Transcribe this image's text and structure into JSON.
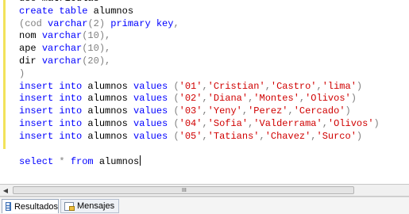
{
  "editor": {
    "lines": [
      [
        {
          "t": "use matriculas",
          "c": "plain"
        }
      ],
      [
        {
          "t": "create table",
          "c": "kw"
        },
        {
          "t": " alumnos",
          "c": "plain"
        }
      ],
      [
        {
          "t": "(cod ",
          "c": "gray"
        },
        {
          "t": "varchar",
          "c": "kw"
        },
        {
          "t": "(2) ",
          "c": "gray"
        },
        {
          "t": "primary key",
          "c": "kw"
        },
        {
          "t": ",",
          "c": "gray"
        }
      ],
      [
        {
          "t": "nom ",
          "c": "plain"
        },
        {
          "t": "varchar",
          "c": "kw"
        },
        {
          "t": "(10),",
          "c": "gray"
        }
      ],
      [
        {
          "t": "ape ",
          "c": "plain"
        },
        {
          "t": "varchar",
          "c": "kw"
        },
        {
          "t": "(10),",
          "c": "gray"
        }
      ],
      [
        {
          "t": "dir ",
          "c": "plain"
        },
        {
          "t": "varchar",
          "c": "kw"
        },
        {
          "t": "(20),",
          "c": "gray"
        }
      ],
      [
        {
          "t": ")",
          "c": "gray"
        }
      ],
      [
        {
          "t": "insert into",
          "c": "kw"
        },
        {
          "t": " alumnos ",
          "c": "plain"
        },
        {
          "t": "values",
          "c": "kw"
        },
        {
          "t": " (",
          "c": "gray"
        },
        {
          "t": "'01'",
          "c": "str"
        },
        {
          "t": ",",
          "c": "gray"
        },
        {
          "t": "'Cristian'",
          "c": "str"
        },
        {
          "t": ",",
          "c": "gray"
        },
        {
          "t": "'Castro'",
          "c": "str"
        },
        {
          "t": ",",
          "c": "gray"
        },
        {
          "t": "'lima'",
          "c": "str"
        },
        {
          "t": ")",
          "c": "gray"
        }
      ],
      [
        {
          "t": "insert into",
          "c": "kw"
        },
        {
          "t": " alumnos ",
          "c": "plain"
        },
        {
          "t": "values",
          "c": "kw"
        },
        {
          "t": " (",
          "c": "gray"
        },
        {
          "t": "'02'",
          "c": "str"
        },
        {
          "t": ",",
          "c": "gray"
        },
        {
          "t": "'Diana'",
          "c": "str"
        },
        {
          "t": ",",
          "c": "gray"
        },
        {
          "t": "'Montes'",
          "c": "str"
        },
        {
          "t": ",",
          "c": "gray"
        },
        {
          "t": "'Olivos'",
          "c": "str"
        },
        {
          "t": ")",
          "c": "gray"
        }
      ],
      [
        {
          "t": "insert into",
          "c": "kw"
        },
        {
          "t": " alumnos ",
          "c": "plain"
        },
        {
          "t": "values",
          "c": "kw"
        },
        {
          "t": " (",
          "c": "gray"
        },
        {
          "t": "'03'",
          "c": "str"
        },
        {
          "t": ",",
          "c": "gray"
        },
        {
          "t": "'Yeny'",
          "c": "str"
        },
        {
          "t": ",",
          "c": "gray"
        },
        {
          "t": "'Perez'",
          "c": "str"
        },
        {
          "t": ",",
          "c": "gray"
        },
        {
          "t": "'Cercado'",
          "c": "str"
        },
        {
          "t": ")",
          "c": "gray"
        }
      ],
      [
        {
          "t": "insert into",
          "c": "kw"
        },
        {
          "t": " alumnos ",
          "c": "plain"
        },
        {
          "t": "values",
          "c": "kw"
        },
        {
          "t": " (",
          "c": "gray"
        },
        {
          "t": "'04'",
          "c": "str"
        },
        {
          "t": ",",
          "c": "gray"
        },
        {
          "t": "'Sofia'",
          "c": "str"
        },
        {
          "t": ",",
          "c": "gray"
        },
        {
          "t": "'Valderrama'",
          "c": "str"
        },
        {
          "t": ",",
          "c": "gray"
        },
        {
          "t": "'Olivos'",
          "c": "str"
        },
        {
          "t": ")",
          "c": "gray"
        }
      ],
      [
        {
          "t": "insert into",
          "c": "kw"
        },
        {
          "t": " alumnos ",
          "c": "plain"
        },
        {
          "t": "values",
          "c": "kw"
        },
        {
          "t": " (",
          "c": "gray"
        },
        {
          "t": "'05'",
          "c": "str"
        },
        {
          "t": ",",
          "c": "gray"
        },
        {
          "t": "'Tatians'",
          "c": "str"
        },
        {
          "t": ",",
          "c": "gray"
        },
        {
          "t": "'Chavez'",
          "c": "str"
        },
        {
          "t": ",",
          "c": "gray"
        },
        {
          "t": "'Surco'",
          "c": "str"
        },
        {
          "t": ")",
          "c": "gray"
        }
      ],
      [],
      [
        {
          "t": "select",
          "c": "kw"
        },
        {
          "t": " * ",
          "c": "gray"
        },
        {
          "t": "from",
          "c": "kw"
        },
        {
          "t": " alumnos",
          "c": "plain"
        }
      ]
    ],
    "cursor_line": 13
  },
  "scrollbar": {
    "left_arrow_icon": "arrow-left-icon",
    "grip_label": "III"
  },
  "tabs": [
    {
      "label": "Resultados",
      "icon": "results-grid-icon",
      "active": true
    },
    {
      "label": "Mensajes",
      "icon": "messages-icon",
      "active": false
    }
  ],
  "colors": {
    "keyword": "#0000ff",
    "string": "#d00000",
    "punctuation": "#808080",
    "change_marker": "#f2e25a"
  }
}
